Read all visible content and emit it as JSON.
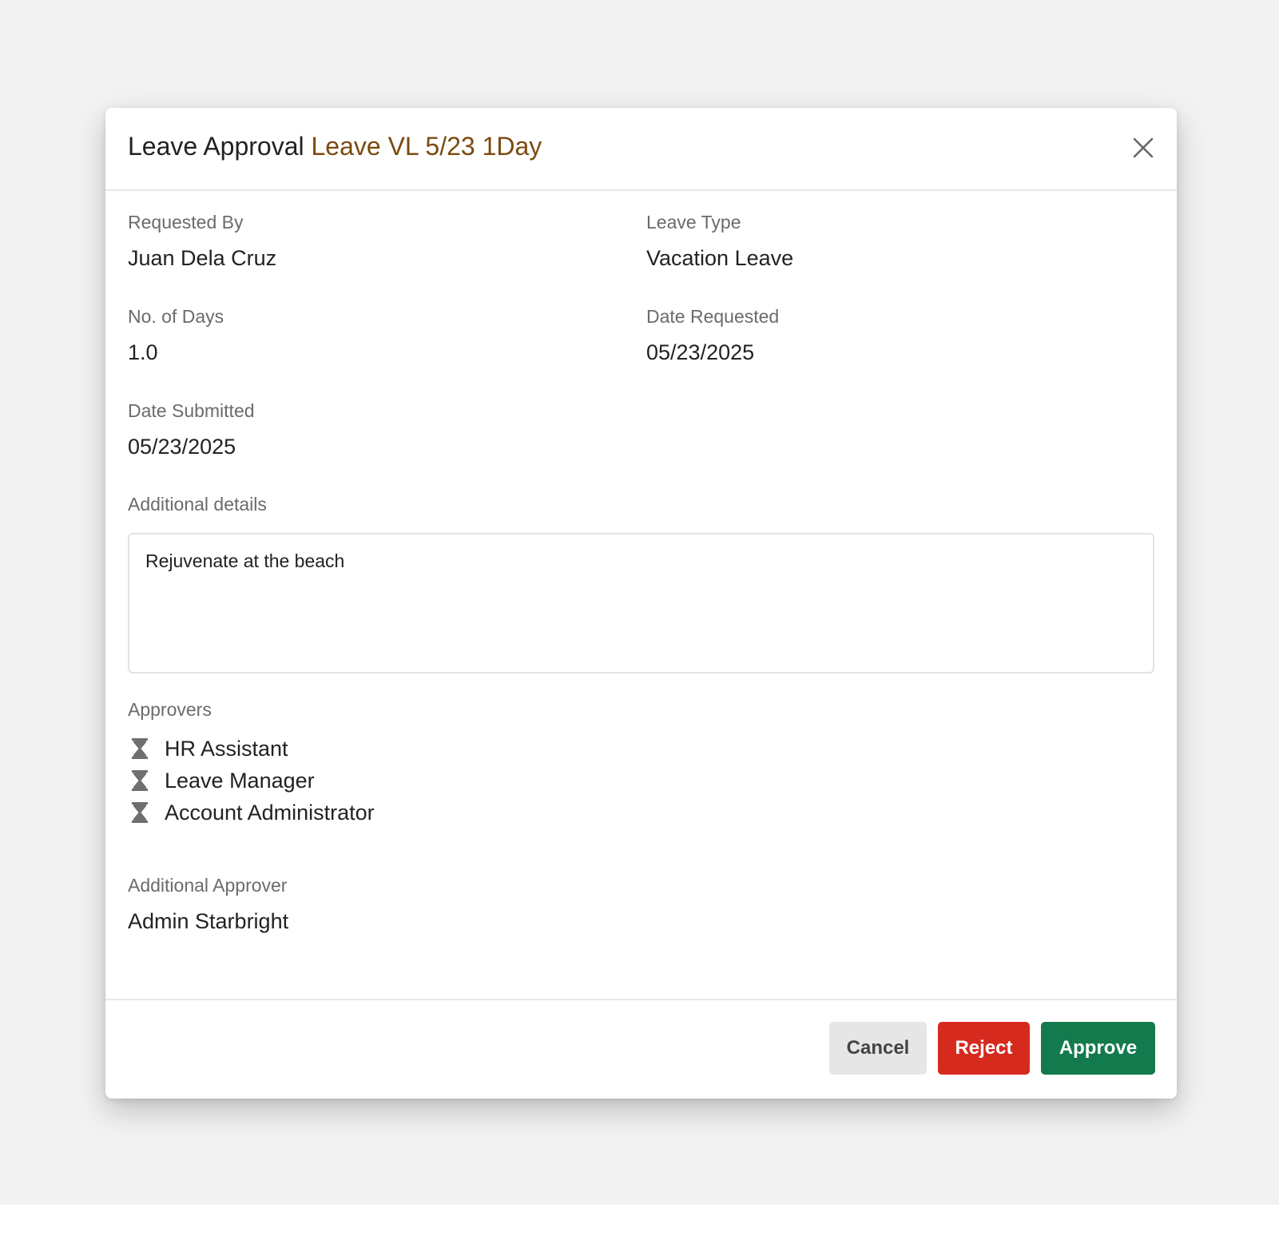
{
  "modal": {
    "title": "Leave Approval",
    "title_accent": "Leave VL 5/23 1Day",
    "close_icon": "close-icon"
  },
  "fields": {
    "requested_by": {
      "label": "Requested By",
      "value": "Juan Dela Cruz"
    },
    "leave_type": {
      "label": "Leave Type",
      "value": "Vacation Leave"
    },
    "no_of_days": {
      "label": "No. of Days",
      "value": "1.0"
    },
    "date_requested": {
      "label": "Date Requested",
      "value": "05/23/2025"
    },
    "date_submitted": {
      "label": "Date Submitted",
      "value": "05/23/2025"
    }
  },
  "additional_details": {
    "label": "Additional details",
    "value": "Rejuvenate at the beach"
  },
  "approvers": {
    "label": "Approvers",
    "status_icon": "hourglass-icon",
    "items": [
      {
        "name": "HR Assistant"
      },
      {
        "name": "Leave Manager"
      },
      {
        "name": "Account Administrator"
      }
    ]
  },
  "additional_approver": {
    "label": "Additional Approver",
    "value": "Admin Starbright"
  },
  "footer": {
    "cancel_label": "Cancel",
    "reject_label": "Reject",
    "approve_label": "Approve"
  },
  "colors": {
    "title_accent": "#7b4a0f",
    "reject": "#d62a1f",
    "approve": "#137a4e",
    "cancel": "#e6e6e6"
  }
}
